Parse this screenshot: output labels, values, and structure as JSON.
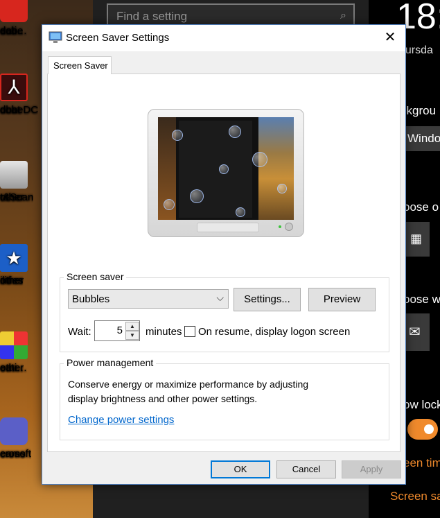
{
  "desktop": {
    "icons": [
      {
        "line1": "dobe",
        "line2": "eati…"
      },
      {
        "line1": "dobe",
        "line2": "obat DC"
      },
      {
        "line1": "other",
        "line2": "t&Scan"
      },
      {
        "line1": "other",
        "line2": "ilities"
      },
      {
        "line1": "other",
        "line2": "eati…"
      },
      {
        "line1": "crosoft",
        "line2": "eams"
      }
    ]
  },
  "settings": {
    "search_placeholder": "Find a setting"
  },
  "lock_panel": {
    "time": "18:",
    "day": "hursda",
    "background_label": "ckgrou",
    "background_value": "Window",
    "choose_app_label": "oose o",
    "choose_status_label": "oose w",
    "show_lock_label": "ow lock",
    "screen_timeout_link": "een tim",
    "screen_saver_link": "Screen sa"
  },
  "dialog": {
    "title": "Screen Saver Settings",
    "close_glyph": "✕",
    "tab_label": "Screen Saver",
    "screen_saver": {
      "group_title": "Screen saver",
      "selected": "Bubbles",
      "settings_button": "Settings...",
      "preview_button": "Preview",
      "wait_label": "Wait:",
      "wait_value": "5",
      "minutes_label": "minutes",
      "resume_label": "On resume, display logon screen",
      "resume_checked": false
    },
    "power": {
      "group_title": "Power management",
      "description_line1": "Conserve energy or maximize performance by adjusting",
      "description_line2": "display brightness and other power settings.",
      "link": "Change power settings"
    },
    "buttons": {
      "ok": "OK",
      "cancel": "Cancel",
      "apply": "Apply"
    }
  },
  "colors": {
    "accent": "#0078d7",
    "link": "#0066cc",
    "lock_accent": "#f08a2c"
  }
}
